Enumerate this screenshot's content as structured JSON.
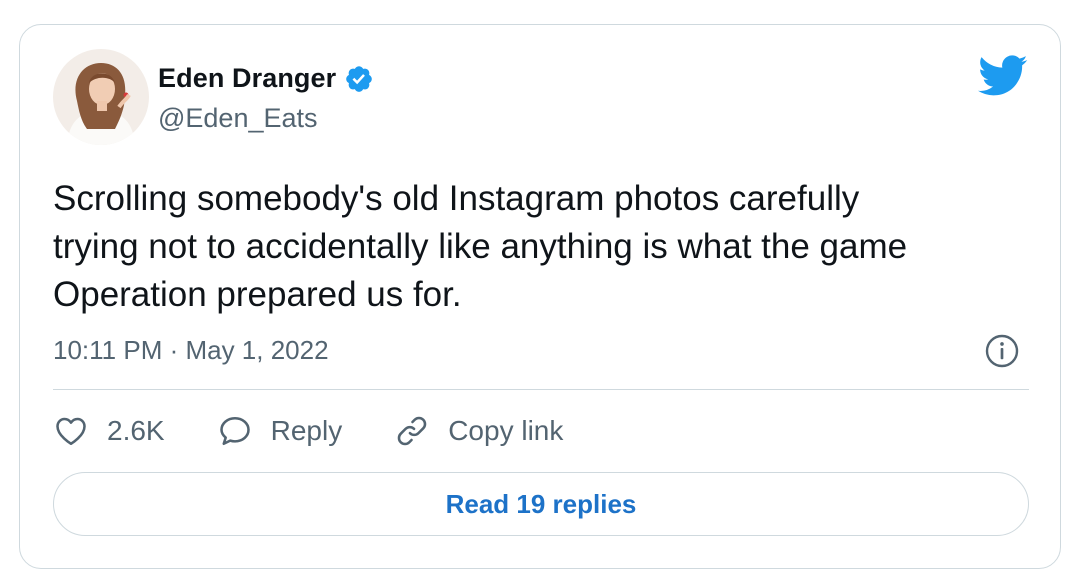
{
  "tweet": {
    "author": {
      "display_name": "Eden Dranger",
      "handle": "@Eden_Eats",
      "verified": true
    },
    "text": "Scrolling somebody's old Instagram photos carefully\ntrying not to accidentally like anything is what the game\nOperation prepared us for.",
    "timestamp": "10:11 PM · May 1, 2022",
    "actions": {
      "likes": "2.6K",
      "reply_label": "Reply",
      "copy_link_label": "Copy link"
    },
    "read_replies_label": "Read 19 replies"
  },
  "icons": {
    "logo": "twitter-bird-icon",
    "verified": "verified-badge-icon",
    "info": "info-icon",
    "like": "heart-icon",
    "reply": "speech-bubble-icon",
    "copy_link": "link-icon"
  },
  "colors": {
    "brand_blue": "#1d9bf0",
    "link_blue": "#1d72c8",
    "text_primary": "#0f1419",
    "text_secondary": "#536471",
    "border": "#cfd9de"
  }
}
